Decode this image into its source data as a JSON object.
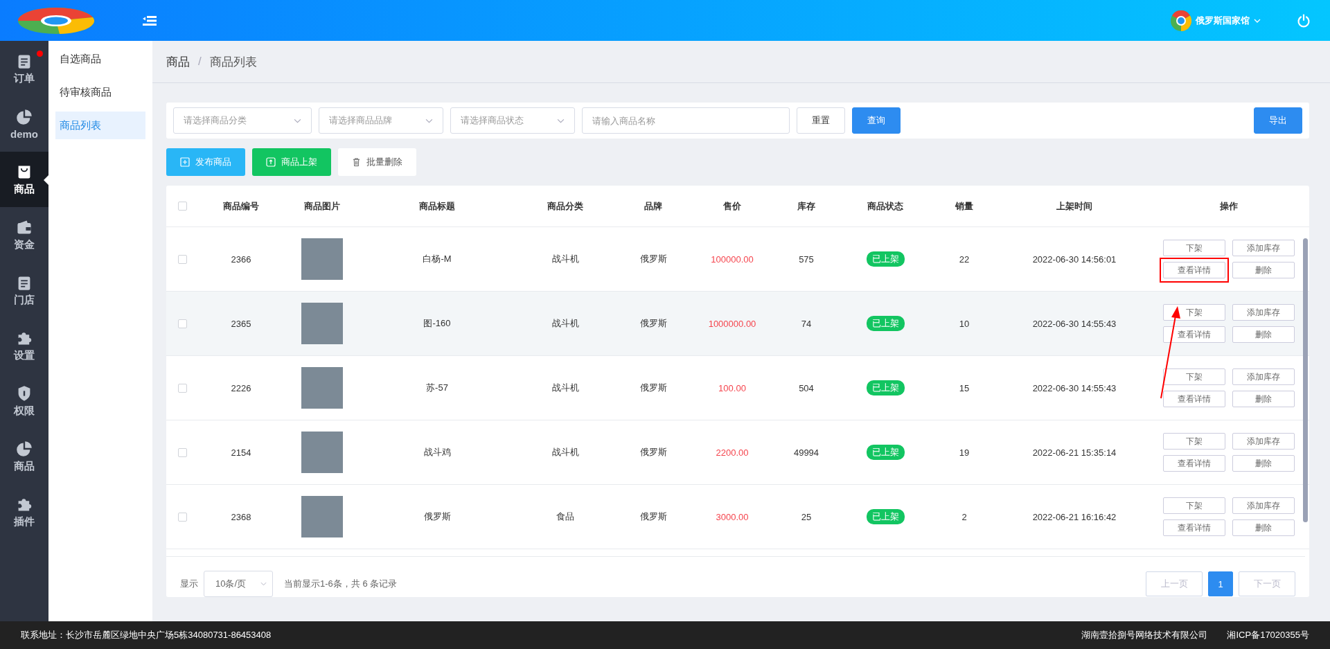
{
  "header": {
    "user_name": "俄罗斯国家馆"
  },
  "sidebar": {
    "items": [
      {
        "label": "订单",
        "kind": "clipboard",
        "selected": false,
        "badge": true
      },
      {
        "label": "demo",
        "kind": "pie",
        "selected": false,
        "badge": false
      },
      {
        "label": "商品",
        "kind": "bag",
        "selected": true,
        "badge": false
      },
      {
        "label": "资金",
        "kind": "wallet",
        "selected": false,
        "badge": false
      },
      {
        "label": "门店",
        "kind": "clipboard",
        "selected": false,
        "badge": false
      },
      {
        "label": "设置",
        "kind": "puzzle",
        "selected": false,
        "badge": false
      },
      {
        "label": "权限",
        "kind": "shield",
        "selected": false,
        "badge": false
      },
      {
        "label": "商品",
        "kind": "pie",
        "selected": false,
        "badge": false
      },
      {
        "label": "插件",
        "kind": "puzzle",
        "selected": false,
        "badge": false
      }
    ]
  },
  "submenu": {
    "items": [
      {
        "label": "自选商品",
        "selected": false
      },
      {
        "label": "待审核商品",
        "selected": false
      },
      {
        "label": "商品列表",
        "selected": true
      }
    ]
  },
  "breadcrumb": {
    "items": [
      "商品",
      "商品列表"
    ],
    "separator": "/"
  },
  "filters": {
    "selects": [
      "请选择商品分类",
      "请选择商品品牌",
      "请选择商品状态"
    ],
    "name_placeholder": "请输入商品名称",
    "reset": "重置",
    "query": "查询",
    "export": "导出"
  },
  "actions": [
    {
      "label": "发布商品",
      "kind": "publish"
    },
    {
      "label": "商品上架",
      "kind": "shelve"
    },
    {
      "label": "批量删除",
      "kind": "delete"
    }
  ],
  "table": {
    "all_checked": false,
    "columns": [
      "商品编号",
      "商品图片",
      "商品标题",
      "商品分类",
      "品牌",
      "售价",
      "库存",
      "商品状态",
      "销量",
      "上架时间",
      "操作"
    ],
    "rows": [
      {
        "id": "2366",
        "title": "白杨-M",
        "category": "战斗机",
        "brand": "俄罗斯",
        "price": "100000.00",
        "stock": "575",
        "status": "已上架",
        "sales": "22",
        "time": "2022-06-30 14:56:01",
        "hovered": false,
        "checked": false,
        "ops": [
          "下架",
          "添加库存",
          "查看详情",
          "删除"
        ],
        "annotated": true
      },
      {
        "id": "2365",
        "title": "图-160",
        "category": "战斗机",
        "brand": "俄罗斯",
        "price": "1000000.00",
        "stock": "74",
        "status": "已上架",
        "sales": "10",
        "time": "2022-06-30 14:55:43",
        "hovered": true,
        "checked": false,
        "ops": [
          "下架",
          "添加库存",
          "查看详情",
          "删除"
        ],
        "annotated": false
      },
      {
        "id": "2226",
        "title": "苏-57",
        "category": "战斗机",
        "brand": "俄罗斯",
        "price": "100.00",
        "stock": "504",
        "status": "已上架",
        "sales": "15",
        "time": "2022-06-30 14:55:43",
        "hovered": false,
        "checked": false,
        "ops": [
          "下架",
          "添加库存",
          "查看详情",
          "删除"
        ],
        "annotated": false
      },
      {
        "id": "2154",
        "title": "战斗鸡",
        "category": "战斗机",
        "brand": "俄罗斯",
        "price": "2200.00",
        "stock": "49994",
        "status": "已上架",
        "sales": "19",
        "time": "2022-06-21 15:35:14",
        "hovered": false,
        "checked": false,
        "ops": [
          "下架",
          "添加库存",
          "查看详情",
          "删除"
        ],
        "annotated": false
      },
      {
        "id": "2368",
        "title": "俄罗斯",
        "category": "食品",
        "brand": "俄罗斯",
        "price": "3000.00",
        "stock": "25",
        "status": "已上架",
        "sales": "2",
        "time": "2022-06-21 16:16:42",
        "hovered": false,
        "checked": false,
        "ops": [
          "下架",
          "添加库存",
          "查看详情",
          "删除"
        ],
        "annotated": false
      }
    ]
  },
  "pagination": {
    "show_label": "显示",
    "page_size": "10条/页",
    "summary": "当前显示1-6条，共 6 条记录",
    "prev": "上一页",
    "prev_disabled": true,
    "pages": [
      {
        "label": "1",
        "selected": true
      }
    ],
    "next": "下一页",
    "next_disabled": true
  },
  "footer": {
    "address": "联系地址：长沙市岳麓区绿地中央广场5栋34080731-86453408",
    "company": "湖南壹拾捌号网络技术有限公司",
    "icp": "湘ICP备17020355号"
  }
}
